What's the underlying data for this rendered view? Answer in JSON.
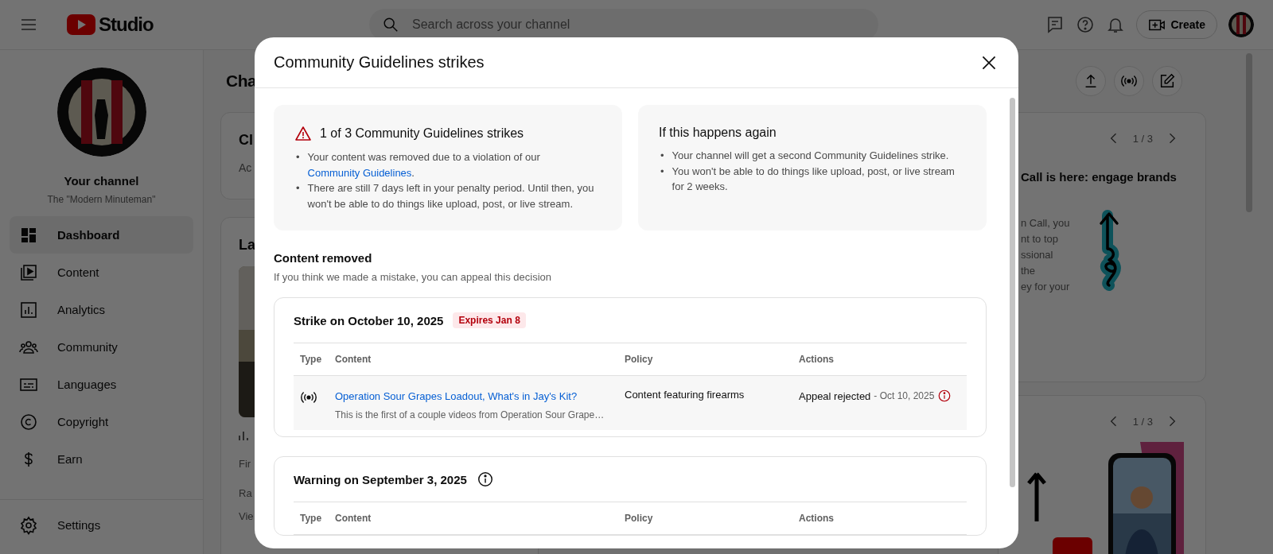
{
  "topbar": {
    "logo_text": "Studio",
    "search": {
      "placeholder": "Search across your channel"
    },
    "create_button": "Create"
  },
  "sidebar": {
    "channel_title": "Your channel",
    "channel_name": "The \"Modern Minuteman\"",
    "items": [
      {
        "label": "Dashboard",
        "kind": "dashboard",
        "selected": true
      },
      {
        "label": "Content",
        "kind": "content",
        "selected": false
      },
      {
        "label": "Analytics",
        "kind": "analytics",
        "selected": false
      },
      {
        "label": "Community",
        "kind": "community",
        "selected": false
      },
      {
        "label": "Languages",
        "kind": "languages",
        "selected": false
      },
      {
        "label": "Copyright",
        "kind": "copyright",
        "selected": false
      },
      {
        "label": "Earn",
        "kind": "earn",
        "selected": false
      }
    ],
    "footer_items": [
      {
        "label": "Settings",
        "kind": "settings",
        "selected": false
      }
    ]
  },
  "background": {
    "page_title": "Cha",
    "left_cards": [
      {
        "kind": "text",
        "title": "Cl",
        "rows": [
          "Ac"
        ]
      },
      {
        "kind": "video",
        "title": "La",
        "rows": [
          "Fir",
          "Ra",
          "Vie"
        ]
      }
    ],
    "right_cards": [
      {
        "kind": "illustration",
        "pager": "1 / 3",
        "title": "Call is here: engage brands",
        "lines": [
          "n Call, you",
          "nt to top",
          "ssional",
          "the",
          "ey for your"
        ]
      },
      {
        "kind": "picture",
        "pager": "1 / 3"
      }
    ]
  },
  "dialog": {
    "title": "Community Guidelines strikes",
    "panels": [
      {
        "kind": "warning",
        "heading": "1 of 3 Community Guidelines strikes",
        "bullets": [
          {
            "marker": "•",
            "text": "Your content was removed due to a violation of our ",
            "link": "Community Guidelines",
            "after": "."
          },
          {
            "marker": "•",
            "text": "There are still 7 days left in your penalty period. Until then, you won't be able to do things like upload, post, or live stream."
          }
        ]
      },
      {
        "kind": "plain",
        "heading": "If this happens again",
        "bullets": [
          {
            "marker": "•",
            "text": "Your channel will get a second Community Guidelines strike."
          },
          {
            "marker": "•",
            "text": "You won't be able to do things like upload, post, or live stream for 2 weeks."
          }
        ]
      }
    ],
    "section": {
      "title": "Content removed",
      "subtitle": "If you think we made a mistake, you can appeal this decision"
    },
    "records": [
      {
        "kind": "strike",
        "title": "Strike on October 10, 2025",
        "badge": "Expires Jan 8",
        "columns": [
          "Type",
          "Content",
          "Policy",
          "Actions"
        ],
        "rows": [
          {
            "kind": "live",
            "title": "Operation Sour Grapes Loadout, What's in Jay's Kit?",
            "description": "This is the first of a couple videos from Operation Sour Grape…",
            "policy": "Content featuring firearms",
            "action": "Appeal rejected",
            "action_date": "- Oct 10, 2025"
          }
        ]
      },
      {
        "kind": "warning",
        "title": "Warning on September 3, 2025",
        "columns": [
          "Type",
          "Content",
          "Policy",
          "Actions"
        ]
      }
    ]
  }
}
